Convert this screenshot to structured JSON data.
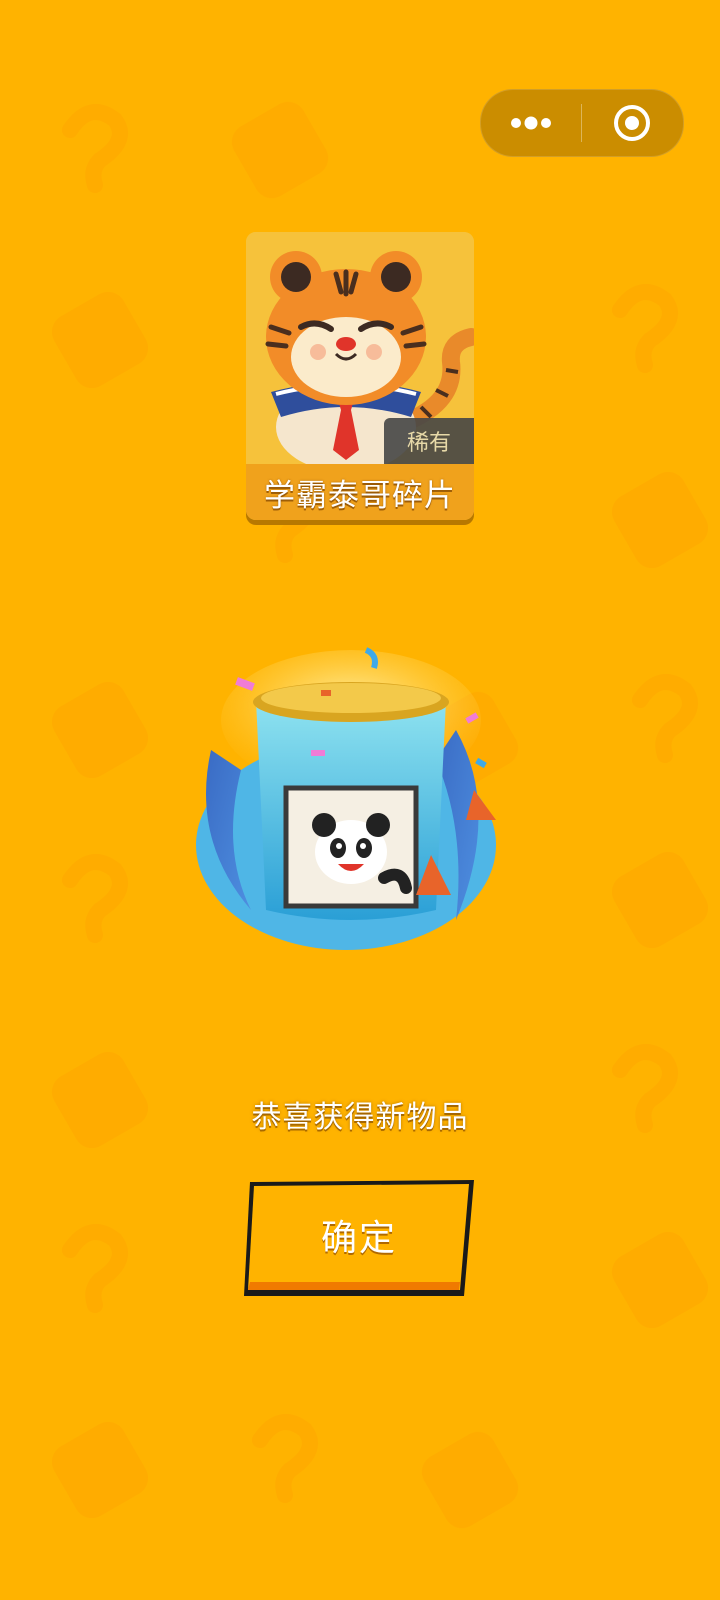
{
  "capsule": {
    "more_icon": "more-dots-icon",
    "close_icon": "target-circle-icon"
  },
  "reward": {
    "rarity": "稀有",
    "name": "学霸泰哥碎片",
    "image": "tiger-character-illustration"
  },
  "gift": {
    "image": "panda-gift-box-illustration"
  },
  "message": "恭喜获得新物品",
  "confirm_label": "确定",
  "colors": {
    "background": "#FFB300",
    "card": "#F6C23B",
    "card_name_bar": "#F0A21C",
    "rarity_tag": "#464646",
    "button": "#FFB300"
  }
}
